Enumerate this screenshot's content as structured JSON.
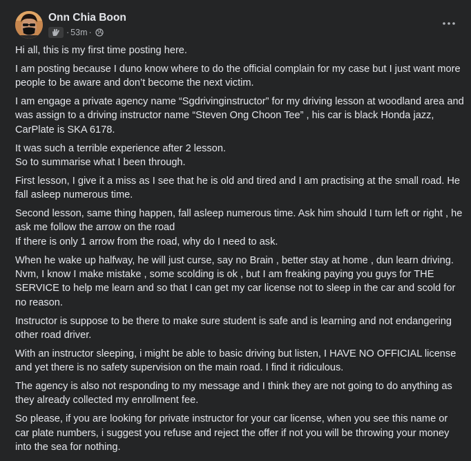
{
  "author": {
    "name": "Onn Chia Boon",
    "timestamp": "53m",
    "badge_icon": "clapping-hands-icon",
    "audience_icon": "globe-icon"
  },
  "menu": {
    "more_icon": "more-options-icon"
  },
  "paragraphs": [
    "Hi all, this is my first time posting here.",
    "I am posting because I duno know where to do the official complain for my case but I just want more people to be aware and don’t become the next victim.",
    "I am engage a private agency name “Sgdrivinginstructor” for my driving lesson at woodland area and was assign to a driving instructor name “Steven Ong Choon Tee” , his car is black Honda jazz, CarPlate is SKA 6178.",
    "It was such a terrible experience after 2 lesson.\nSo to summarise what I been through.",
    "First lesson, I give it a miss as I see that he is old and tired and I am practising at the small road. He fall asleep numerous time.",
    "Second lesson, same thing happen, fall asleep numerous time. Ask him should I turn left or right , he ask me follow the arrow on the road\nIf there is only 1 arrow from the road, why do I need to ask.",
    "When he wake up halfway, he will just curse, say no Brain , better stay at home , dun learn driving. Nvm, I know I make mistake ,  some scolding is ok  , but I am freaking paying you guys for THE SERVICE to help me learn and so that I can get my car license not to sleep in the car and scold for no reason.",
    "Instructor is suppose to be there to make sure student is safe and is learning and not endangering other road driver.",
    "With an instructor sleeping, i might be able to basic driving but listen, I HAVE NO OFFICIAL license and yet there is no safety supervision on the main road. I find it ridiculous.",
    "The agency is also not responding to my message and I think they are not going to do anything as they already collected my enrollment fee.",
    "So please, if you are looking for private instructor for your car license, when you see this name or car plate numbers, i suggest you refuse and reject the offer if not you will be throwing your money into the sea for nothing."
  ]
}
